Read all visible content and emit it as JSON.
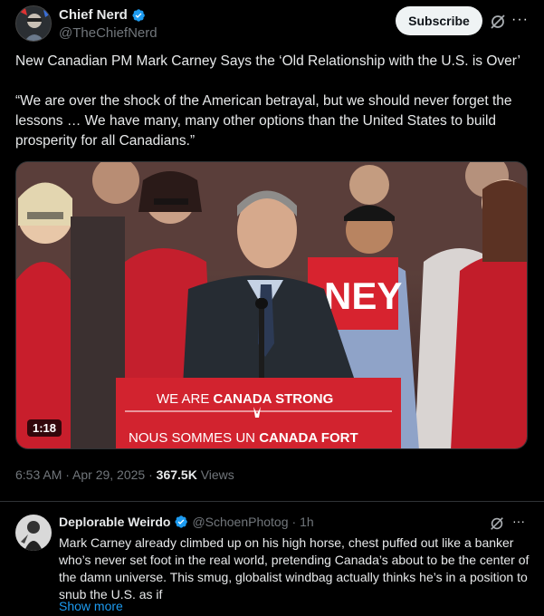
{
  "post": {
    "author": {
      "display_name": "Chief Nerd",
      "handle": "@TheChiefNerd",
      "verified": true
    },
    "subscribe_label": "Subscribe",
    "more_label": "···",
    "text_paragraphs": [
      "New Canadian PM Mark Carney Says the ‘Old Relationship with the U.S. is Over’",
      "“We are over the shock of the American betrayal, but we should never forget the lessons … We have many, many other options than the United States to build prosperity for all Canadians.”"
    ],
    "media": {
      "duration": "1:18",
      "podium_line1_prefix": "WE ARE ",
      "podium_line1_bold": "CANADA STRONG",
      "podium_line2_prefix": "NOUS SOMMES UN ",
      "podium_line2_bold": "CANADA FORT",
      "sign_text": "NEY"
    },
    "timestamp": "6:53 AM · Apr 29, 2025 · ",
    "views_count": "367.5K",
    "views_label": " Views"
  },
  "reply": {
    "display_name": "Deplorable Weirdo",
    "handle": "@SchoenPhotog",
    "time": "· 1h",
    "verified": true,
    "more_label": "···",
    "text": "Mark Carney already climbed up on his high horse, chest puffed out like a banker who’s never set foot in the real world, pretending Canada’s about to be the center of the damn universe. This smug, globalist windbag actually thinks he’s in a position to snub the U.S. as if",
    "show_more": "Show more"
  },
  "colors": {
    "background": "#000000",
    "text": "#e7e9ea",
    "secondary": "#71767b",
    "accent": "#1d9bf0",
    "verified": "#1d9bf0"
  }
}
